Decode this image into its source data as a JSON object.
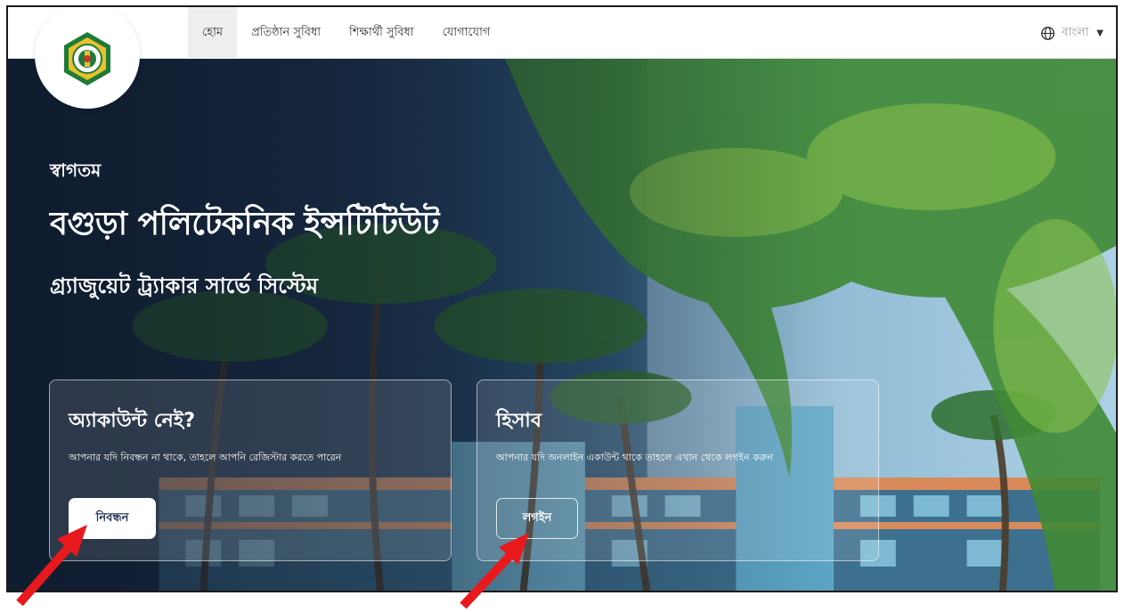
{
  "nav": {
    "links": [
      "হোম",
      "প্রতিষ্ঠান সুবিধা",
      "শিক্ষার্থী সুবিধা",
      "যোগাযোগ"
    ],
    "language": "বাংলা",
    "language_icon": "globe-icon",
    "language_caret_icon": "caret-down-icon",
    "logo_icon": "institute-logo"
  },
  "hero": {
    "welcome": "স্বাগতম",
    "institute_name": "বগুড়া পলিটেকনিক ইন্সটিটিউট",
    "subtitle": "গ্র্যাজুয়েট ট্র্যাকার সার্ভে সিস্টেম"
  },
  "cards": {
    "register": {
      "title": "অ্যাকাউন্ট নেই?",
      "text": "আপনার যদি নিবন্ধন না থাকে, তাহলে আপনি রেজিস্টার করতে পারেন",
      "button": "নিবন্ধন"
    },
    "login": {
      "title": "হিসাব",
      "text": "আপনার যদি অনলাইন একাউন্ট থাকে তাহলে এখান থেকে লগইন করুন",
      "button": "লগইন"
    }
  },
  "colors": {
    "annotation_arrow": "#e8191c",
    "navy": "#1a2d4d"
  }
}
